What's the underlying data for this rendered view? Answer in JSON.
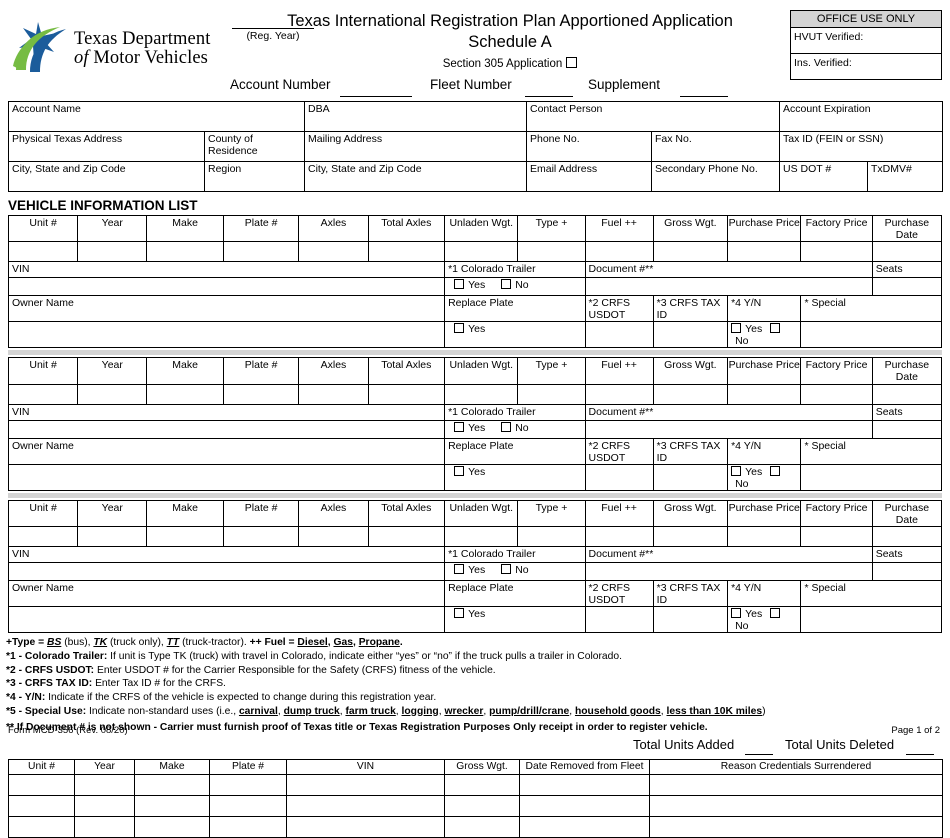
{
  "header": {
    "logo": {
      "line1": "Texas Department",
      "line2_italic": "of",
      "line2_rest": " Motor Vehicles",
      "star_blue": "#1b5c9b",
      "swoosh_green": "#76bc43"
    },
    "reg_year_label": "(Reg. Year)",
    "title_line1": "Texas International Registration Plan Apportioned Application",
    "title_line2": "Schedule A",
    "section_305_label": "Section 305 Application",
    "account_number_label": "Account Number",
    "fleet_number_label": "Fleet Number",
    "supplement_label": "Supplement",
    "office_use": {
      "heading": "OFFICE USE ONLY",
      "row1": "HVUT Verified:",
      "row2": "Ins. Verified:"
    }
  },
  "account_info": {
    "account_name": "Account Name",
    "dba": "DBA",
    "contact_person": "Contact Person",
    "account_expiration": "Account Expiration",
    "physical_texas_address": "Physical Texas Address",
    "county_of_residence": "County of Residence",
    "mailing_address": "Mailing Address",
    "phone_no": "Phone No.",
    "fax_no": "Fax No.",
    "tax_id": "Tax ID (FEIN or SSN)",
    "city_state_zip_1": "City, State and Zip Code",
    "region": "Region",
    "city_state_zip_2": "City, State and Zip Code",
    "email_address": "Email Address",
    "secondary_phone_no": "Secondary Phone No.",
    "us_dot": "US DOT #",
    "txdmv": "TxDMV#"
  },
  "vehicle_section": {
    "title": "VEHICLE INFORMATION LIST",
    "columns": [
      "Unit #",
      "Year",
      "Make",
      "Plate #",
      "Axles",
      "Total Axles",
      "Unladen Wgt.",
      "Type +",
      "Fuel ++",
      "Gross Wgt.",
      "Purchase Price",
      "Factory Price",
      "Purchase Date"
    ],
    "vin_label": "VIN",
    "colorado_trailer_label": "*1 Colorado Trailer",
    "document_label": "Document #**",
    "seats_label": "Seats",
    "owner_name_label": "Owner Name",
    "replace_plate_label": "Replace Plate",
    "crfs_usdot_label": "*2 CRFS USDOT",
    "crfs_tax_id_label": "*3 CRFS TAX ID",
    "yn_label": "*4 Y/N",
    "special_label": "* Special",
    "yes_label": "Yes",
    "no_label": "No",
    "block_count": 3
  },
  "notes": {
    "type_line": {
      "prefix": "+Type = ",
      "bs": "BS",
      "bs_rest": " (bus), ",
      "tk": "TK",
      "tk_rest": " (truck only), ",
      "tt": "TT",
      "tt_rest": " (truck-tractor).  ",
      "fuel_prefix": "++ Fuel = ",
      "fuel_1": "Diesel",
      "fuel_2": "Gas",
      "fuel_3": "Propane",
      "fuel_end": "."
    },
    "n1_label": "*1 - Colorado Trailer:",
    "n1_text": " If unit is Type TK (truck) with travel in Colorado, indicate either “yes” or “no” if the truck pulls a trailer in Colorado.",
    "n2_label": "*2 - CRFS USDOT:",
    "n2_text": " Enter USDOT # for the Carrier Responsible for the Safety (CRFS) fitness of the vehicle.",
    "n3_label": "*3 - CRFS TAX ID:",
    "n3_text": " Enter Tax ID # for the CRFS.",
    "n4_label": "*4 - Y/N:",
    "n4_text": " Indicate if the CRFS of the vehicle is expected to change during this registration year.",
    "n5_label": "*5 - Special Use:",
    "n5_text": " Indicate non-standard uses (i.e., ",
    "n5_uses": [
      "carnival",
      "dump truck",
      "farm truck",
      "logging",
      "wrecker",
      "pump/drill/crane",
      "household goods",
      "less than 10K miles"
    ],
    "n5_close": ")",
    "doc_note": "** If Document # is not shown - Carrier must furnish proof of Texas title or Texas Registration Purposes Only receipt in order to register vehicle."
  },
  "totals": {
    "added_label": "Total Units Added",
    "deleted_label": "Total Units Deleted"
  },
  "deleted_table": {
    "columns": [
      "Unit #",
      "Year",
      "Make",
      "Plate #",
      "VIN",
      "Gross Wgt.",
      "Date Removed from Fleet",
      "Reason Credentials Surrendered"
    ],
    "row_count": 3
  },
  "footer": {
    "form_id": "Form MCD-356  (Rev. 08/20)",
    "page": "Page 1 of 2"
  }
}
